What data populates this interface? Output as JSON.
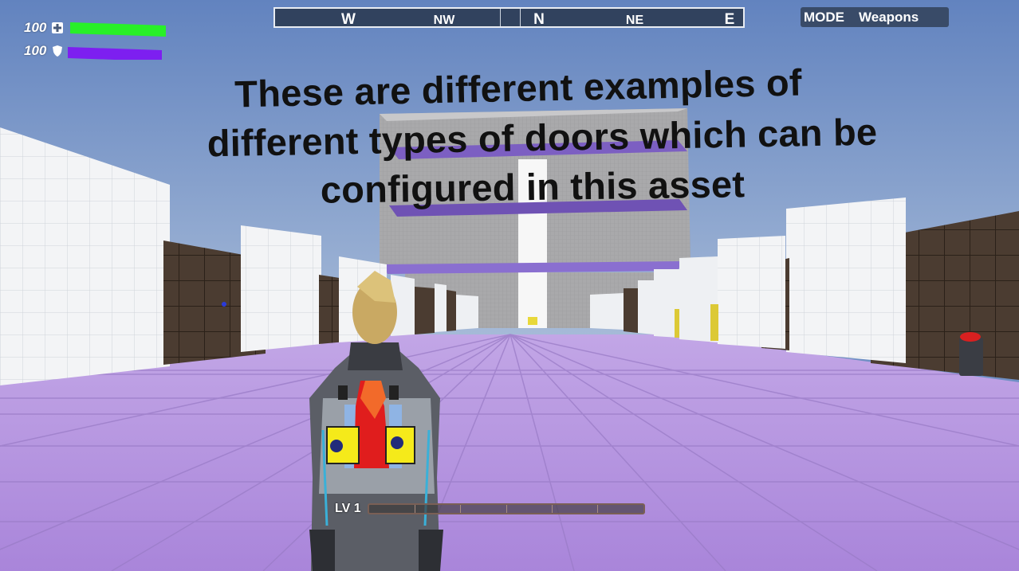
{
  "hud": {
    "health": {
      "value": "100",
      "icon": "medkit-icon",
      "color": "#28f028",
      "level": 1.0
    },
    "shield": {
      "value": "100",
      "icon": "shield-icon",
      "color": "#7d1ff0",
      "level": 1.0
    }
  },
  "compass": {
    "marks": [
      {
        "label": "W",
        "major": true
      },
      {
        "label": "NW",
        "major": false
      },
      {
        "label": "N",
        "major": true
      },
      {
        "label": "NE",
        "major": false
      },
      {
        "label": "E",
        "major": true
      }
    ]
  },
  "mode": {
    "label": "MODE",
    "value": "Weapons"
  },
  "headline": {
    "line1": "These are different examples of",
    "line2": "different types of doors which can be",
    "line3": "configured in this asset"
  },
  "level": {
    "label": "LV 1",
    "progress": 0.0,
    "segments": 6
  },
  "colors": {
    "floor": "#b48ee0",
    "sky": "#6f8fc4",
    "platform": "#7f60c4",
    "wall_white": "#f3f4f6",
    "wall_brown": "#4a3b30"
  }
}
